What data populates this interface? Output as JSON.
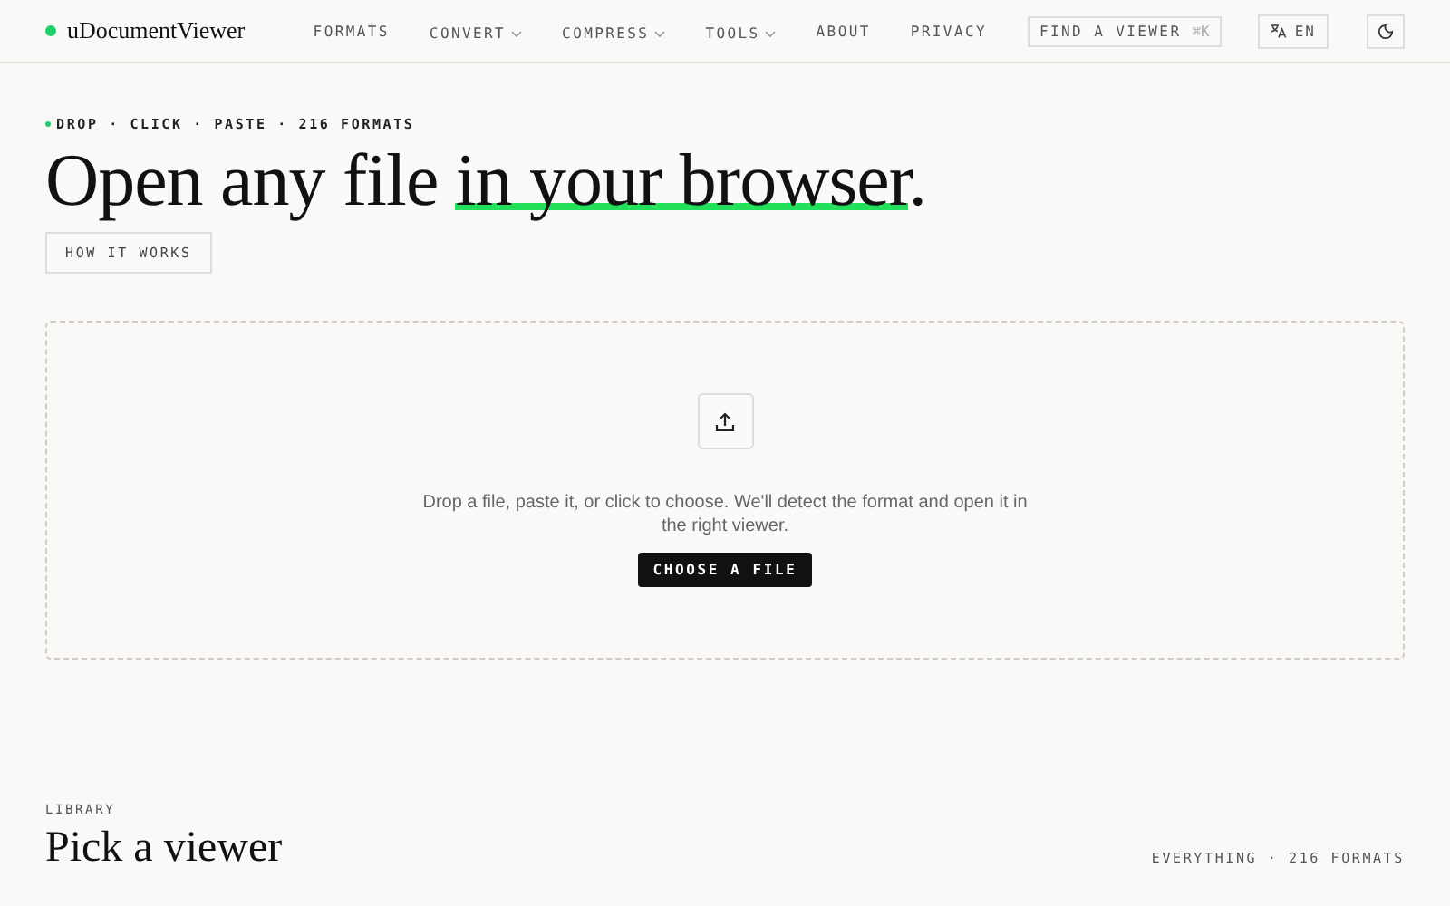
{
  "header": {
    "logo": "uDocumentViewer",
    "nav": [
      {
        "label": "FORMATS",
        "dropdown": false
      },
      {
        "label": "CONVERT",
        "dropdown": true
      },
      {
        "label": "COMPRESS",
        "dropdown": true
      },
      {
        "label": "TOOLS",
        "dropdown": true
      },
      {
        "label": "ABOUT",
        "dropdown": false
      },
      {
        "label": "PRIVACY",
        "dropdown": false
      }
    ],
    "search_button": {
      "label": "FIND A VIEWER",
      "shortcut": "⌘K"
    },
    "language": "EN"
  },
  "hero": {
    "eyebrow": "DROP · CLICK · PASTE · 216 FORMATS",
    "headline": [
      {
        "text": "Open any file ",
        "highlighted": false
      },
      {
        "text": "in your browser",
        "highlighted": true
      },
      {
        "text": ".",
        "highlighted": false
      }
    ],
    "how_button": "HOW IT WORKS"
  },
  "dropzone": {
    "hint": "Drop a file, paste it, or click to choose. We'll detect the format and open it in the right viewer.",
    "button": "CHOOSE A FILE"
  },
  "library": {
    "eyebrow": "LIBRARY",
    "title": "Pick a viewer",
    "count": "EVERYTHING · 216 FORMATS"
  }
}
